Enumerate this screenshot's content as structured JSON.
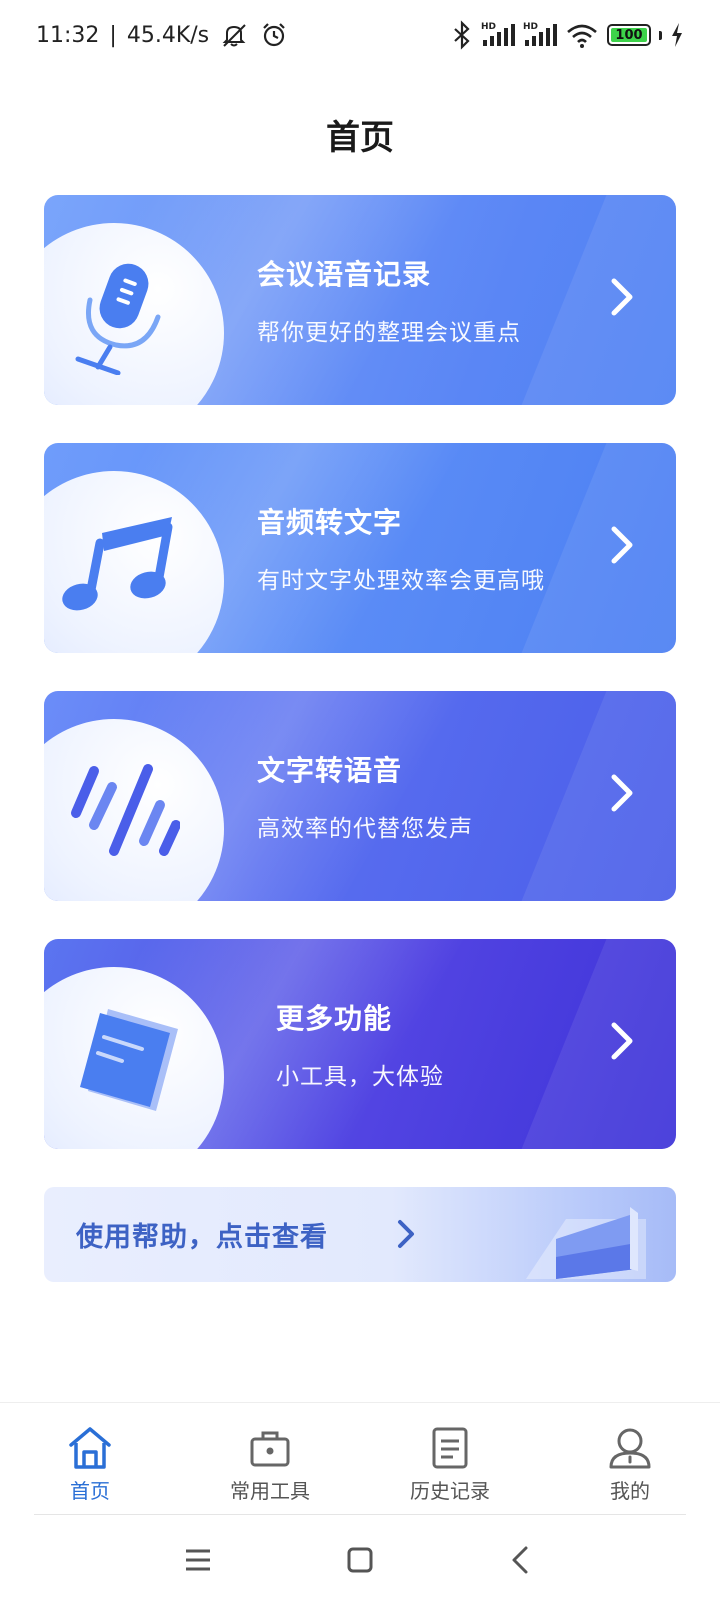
{
  "status_bar": {
    "time": "11:32",
    "separator": "|",
    "net_speed": "45.4K/s",
    "battery": "100",
    "battery_level": 1.0
  },
  "header": {
    "title": "首页"
  },
  "cards": [
    {
      "title": "会议语音记录",
      "subtitle": "帮你更好的整理会议重点",
      "icon": "microphone-icon"
    },
    {
      "title": "音频转文字",
      "subtitle": "有时文字处理效率会更高哦",
      "icon": "music-note-icon"
    },
    {
      "title": "文字转语音",
      "subtitle": "高效率的代替您发声",
      "icon": "sound-wave-icon"
    },
    {
      "title": "更多功能",
      "subtitle": "小工具，大体验",
      "icon": "book-icon"
    }
  ],
  "help": {
    "label": "使用帮助，点击查看"
  },
  "tabs": [
    {
      "label": "首页",
      "icon": "home-icon",
      "active": true
    },
    {
      "label": "常用工具",
      "icon": "toolbox-icon",
      "active": false
    },
    {
      "label": "历史记录",
      "icon": "document-icon",
      "active": false
    },
    {
      "label": "我的",
      "icon": "user-icon",
      "active": false
    }
  ],
  "colors": {
    "accent": "#2a6fd6",
    "help_text": "#3d62c4",
    "card_icon_blue": "#4a7ef0"
  }
}
